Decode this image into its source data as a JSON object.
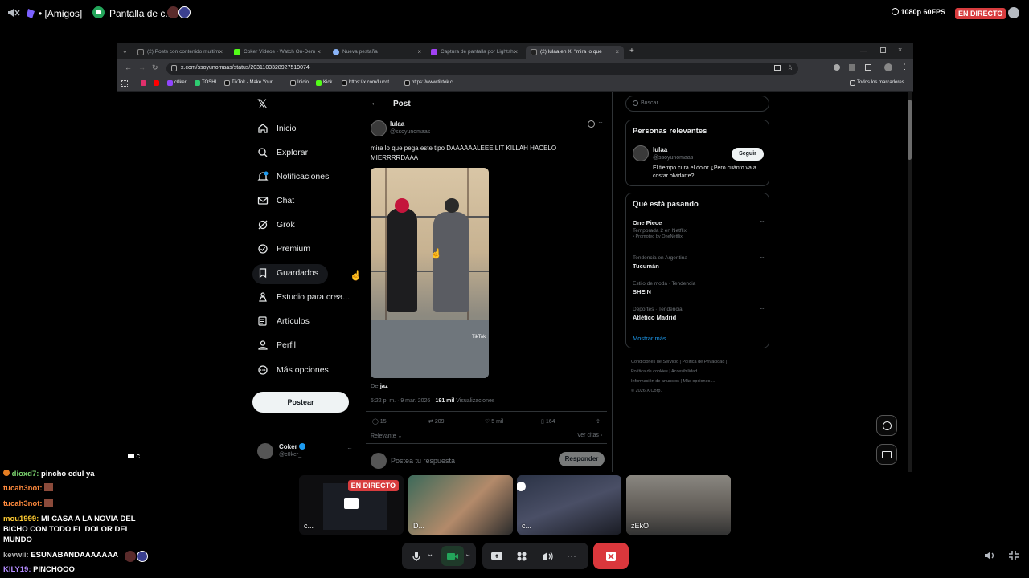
{
  "topbar": {
    "channel": "• [Amigos]",
    "stream_title": "Pantalla de c...",
    "quality": "1080p 60FPS",
    "live_badge": "EN DIRECTO"
  },
  "browser": {
    "tabs": [
      {
        "label": "(2) Posts con contenido multim",
        "color": "#111"
      },
      {
        "label": "Coker Videos - Watch On-Dem",
        "color": "#53fc18"
      },
      {
        "label": "Nueva pestaña",
        "color": "#8ab4f8"
      },
      {
        "label": "Captura de pantalla por Lightsh",
        "color": "#a142f4"
      },
      {
        "label": "(2) lulaa en X: \"mira lo que",
        "color": "#111"
      }
    ],
    "url": "x.com/ssoyunomaas/status/2031103328927519074",
    "bookmarks": [
      {
        "label": "",
        "color": "#e1306c"
      },
      {
        "label": "",
        "color": "#ff0000"
      },
      {
        "label": "c0ker",
        "color": "#9146ff"
      },
      {
        "label": "TOSHI",
        "color": "#2ecc71"
      },
      {
        "label": "TikTok - Make Your...",
        "color": "#111"
      },
      {
        "label": "Inicio",
        "color": "#111"
      },
      {
        "label": "Kick",
        "color": "#53fc18"
      },
      {
        "label": "https://x.com/Lucct...",
        "color": "#111"
      },
      {
        "label": "https://www.tiktok.c...",
        "color": "#111"
      }
    ],
    "all_bookmarks": "Todos los marcadores"
  },
  "x": {
    "nav": [
      {
        "label": "Inicio",
        "icon": "home-icon"
      },
      {
        "label": "Explorar",
        "icon": "search-icon"
      },
      {
        "label": "Notificaciones",
        "icon": "bell-icon"
      },
      {
        "label": "Chat",
        "icon": "mail-icon"
      },
      {
        "label": "Grok",
        "icon": "grok-icon"
      },
      {
        "label": "Premium",
        "icon": "premium-icon"
      },
      {
        "label": "Guardados",
        "icon": "bookmark-icon"
      },
      {
        "label": "Estudio para crea...",
        "icon": "studio-icon"
      },
      {
        "label": "Artículos",
        "icon": "article-icon"
      },
      {
        "label": "Perfil",
        "icon": "profile-icon"
      },
      {
        "label": "Más opciones",
        "icon": "more-icon"
      }
    ],
    "post_button": "Postear",
    "account": {
      "name": "Coker",
      "handle": "@c0ker_"
    },
    "post_header": "Post",
    "tweet": {
      "author": "lulaa",
      "handle": "@ssoyunomaas",
      "text": "mira lo que pega este tipo DAAAAAALEEE LIT KILLAH HACELO MIERRRRDAAA",
      "source_prefix": "De",
      "source_name": "jaz",
      "time": "5:22 p. m. · 9 mar. 2026 · ",
      "views_count": "191 mil",
      "views_label": " Visualizaciones",
      "replies": "15",
      "retweets": "209",
      "likes": "5 mil",
      "bookmarks": "164",
      "sort": "Relevante",
      "quotes": "Ver citas",
      "reply_placeholder": "Postea tu respuesta",
      "reply_button": "Responder",
      "tiktok_watermark": "TikTok"
    },
    "search_placeholder": "Buscar",
    "relevant": {
      "title": "Personas relevantes",
      "name": "lulaa",
      "handle": "@ssoyunomaas",
      "bio": "El tiempo cura el dolor ¿Pero cuánto va a costar olvidarte?",
      "follow": "Seguir"
    },
    "trending": {
      "title": "Qué está pasando",
      "items": [
        {
          "name": "One Piece",
          "meta": "Temporada 2 en Netflix",
          "meta2": "Promoted by OneNetflix"
        },
        {
          "meta": "Tendencia en Argentina",
          "name": "Tucumán"
        },
        {
          "meta": "Estilo de moda · Tendencia",
          "name": "SHEIN"
        },
        {
          "meta": "Deportes · Tendencia",
          "name": "Atlético Madrid"
        }
      ],
      "more": "Mostrar más"
    },
    "footer": {
      "l1a": "Condiciones de Servicio",
      "l1b": "Política de Privacidad",
      "l2a": "Política de cookies",
      "l2b": "Accesibilidad",
      "l3a": "Información de anuncios",
      "l3b": "Más opciones ...",
      "l4": "© 2026 X Corp."
    }
  },
  "discord": {
    "stream_tile_label": "c...",
    "tile_live": "EN DIRECTO",
    "tiles": [
      {
        "label": "c...",
        "bg": "#0e0e10"
      },
      {
        "label": "D...",
        "bg": "#2a3a3a"
      },
      {
        "label": "c...",
        "bg": "#1d2433"
      },
      {
        "label": "zEkO",
        "bg": "#6b6862"
      }
    ],
    "chat": [
      {
        "user": "dioxd7:",
        "msg": " pincho edul ya",
        "color": "#7bd46f"
      },
      {
        "user": "tucah3not:",
        "msg": "",
        "color": "#ff8a3d"
      },
      {
        "user": "tucah3not:",
        "msg": "",
        "color": "#ff8a3d"
      },
      {
        "user": "mou1999:",
        "msg": " MI CASA A LA NOVIA DEL",
        "color": "#ffcc33"
      },
      {
        "user": "",
        "msg": "BICHO CON TODO EL DOLOR DEL",
        "color": "#ffcc33"
      },
      {
        "user": "",
        "msg": "MUNDO",
        "color": "#ffcc33"
      },
      {
        "user": "kevwii:",
        "msg": " ESUNABANDAAAAAAA",
        "color": "#b0b0b0"
      },
      {
        "user": "KILY19:",
        "msg": " PINCHOOO",
        "color": "#b48cff"
      }
    ]
  }
}
